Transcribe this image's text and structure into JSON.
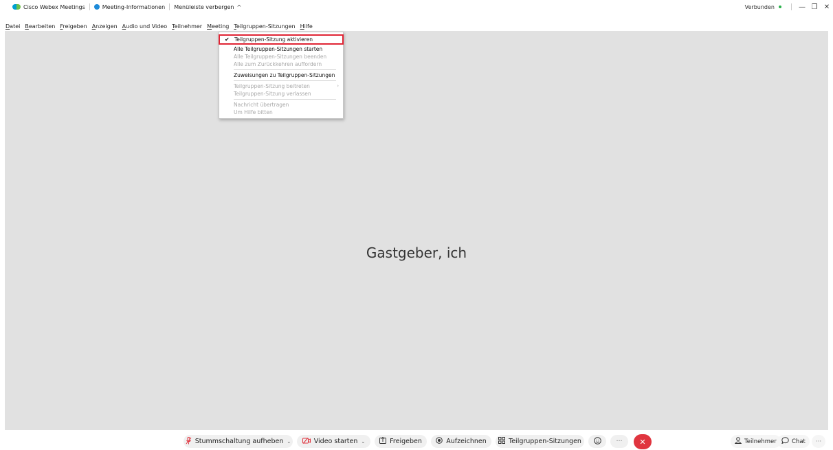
{
  "titlebar": {
    "app_name": "Cisco Webex Meetings",
    "meeting_info": "Meeting-Informationen",
    "hide_menu": "Menüleiste verbergen",
    "hide_menu_chevron": "^",
    "status": "Verbunden",
    "minimize": "—",
    "restore": "❐",
    "close": "✕"
  },
  "menubar": {
    "items": [
      "Datei",
      "Bearbeiten",
      "Freigeben",
      "Anzeigen",
      "Audio und Video",
      "Teilnehmer",
      "Meeting",
      "Teilgruppen-Sitzungen",
      "Hilfe"
    ]
  },
  "breakout_menu": {
    "enable": "Teilgruppen-Sitzung aktivieren",
    "enable_checked": "✔",
    "start_all": "Alle Teilgruppen-Sitzungen starten",
    "end_all": "Alle Teilgruppen-Sitzungen beenden",
    "ask_return": "Alle zum Zurückkehren auffordern",
    "assignments": "Zuweisungen zu Teilgruppen-Sitzungen",
    "join": "Teilgruppen-Sitzung beitreten",
    "join_arrow": "›",
    "leave": "Teilgruppen-Sitzung verlassen",
    "broadcast": "Nachricht übertragen",
    "ask_help": "Um Hilfe bitten"
  },
  "stage": {
    "participant_name": "Gastgeber, ich"
  },
  "toolbar": {
    "unmute": "Stummschaltung aufheben",
    "start_video": "Video starten",
    "share": "Freigeben",
    "record": "Aufzeichnen",
    "breakout": "Teilgruppen-Sitzungen",
    "more": "···",
    "leave": "✕",
    "caret": "⌄",
    "participants": "Teilnehmer",
    "chat": "Chat",
    "more_right": "···"
  },
  "colors": {
    "stage_bg": "#e1e1e1",
    "highlight_border": "#e02434",
    "leave_red": "#e0353f",
    "connected_green": "#2bb24c"
  }
}
